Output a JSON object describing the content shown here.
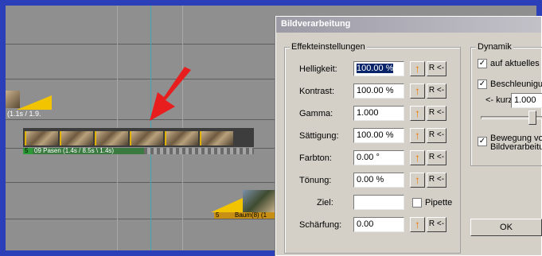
{
  "timeline": {
    "clip1_label": "(1.1s / 1.9.",
    "clip2_label": "09 Pasen (1.4s / 8.5s \\ 1.4s)",
    "clip2_marker": "5",
    "clip3_label": "Baum(8) (1",
    "clip3_marker": "5"
  },
  "dialog": {
    "title": "Bildverarbeitung",
    "effects_group": "Effekteinstellungen",
    "dynamics_group": "Dynamik",
    "rows": [
      {
        "label": "Helligkeit:",
        "value": "100.00 %"
      },
      {
        "label": "Kontrast:",
        "value": "100.00 %"
      },
      {
        "label": "Gamma:",
        "value": "1.000"
      },
      {
        "label": "Sättigung:",
        "value": "100.00 %"
      },
      {
        "label": "Farbton:",
        "value": "0.00 °"
      },
      {
        "label": "Tönung:",
        "value": "0.00 %"
      }
    ],
    "target_label": "Ziel:",
    "target_value": "",
    "pipette_label": "Pipette",
    "sharpness_label": "Schärfung:",
    "sharpness_value": "0.00",
    "reset_label": "R <-",
    "up_glyph": "↑",
    "dyn_current": "auf aktuelles Bi",
    "dyn_accel": "Beschleunigung",
    "dyn_short_label": "<- kurz",
    "dyn_short_value": "1.000",
    "dyn_motion_1": "Bewegung von",
    "dyn_motion_2": "Bildverarbeitung",
    "ok_label": "OK"
  },
  "colors": {
    "frame": "#2a3fb8",
    "accent_arrow": "#e81e1e",
    "up_button": "#f07b00"
  }
}
